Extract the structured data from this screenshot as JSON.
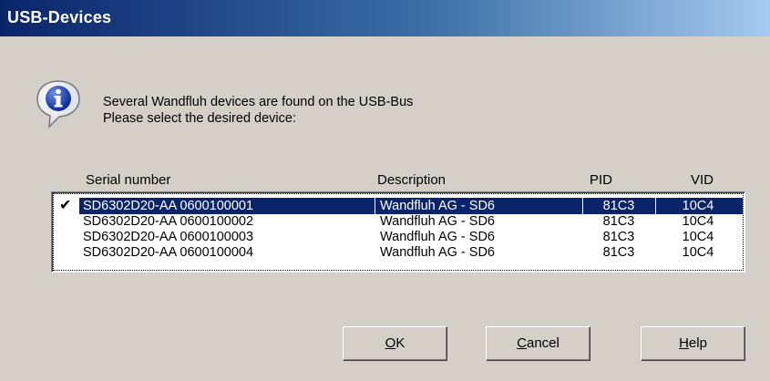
{
  "window": {
    "title": "USB-Devices"
  },
  "message": {
    "icon": "info-icon",
    "line1": "Several Wandfluh devices are found on the USB-Bus",
    "line2": "Please select the desired device:"
  },
  "table": {
    "columns": [
      "Serial number",
      "Description",
      "PID",
      "VID"
    ],
    "rows": [
      {
        "serial": "SD6302D20-AA 0600100001",
        "description": "Wandfluh AG - SD6",
        "pid": "81C3",
        "vid": "10C4",
        "checked": true,
        "selected": true
      },
      {
        "serial": "SD6302D20-AA 0600100002",
        "description": "Wandfluh AG - SD6",
        "pid": "81C3",
        "vid": "10C4",
        "checked": false,
        "selected": false
      },
      {
        "serial": "SD6302D20-AA 0600100003",
        "description": "Wandfluh AG - SD6",
        "pid": "81C3",
        "vid": "10C4",
        "checked": false,
        "selected": false
      },
      {
        "serial": "SD6302D20-AA 0600100004",
        "description": "Wandfluh AG - SD6",
        "pid": "81C3",
        "vid": "10C4",
        "checked": false,
        "selected": false
      }
    ]
  },
  "buttons": {
    "ok": {
      "accel": "O",
      "rest": "K"
    },
    "cancel": {
      "accel": "C",
      "rest": "ancel"
    },
    "help": {
      "accel": "H",
      "rest": "elp"
    }
  },
  "colors": {
    "dialog_bg": "#d4d0c8",
    "titlebar_start": "#0a246a",
    "titlebar_end": "#a6caf0",
    "selection": "#0a246a"
  }
}
